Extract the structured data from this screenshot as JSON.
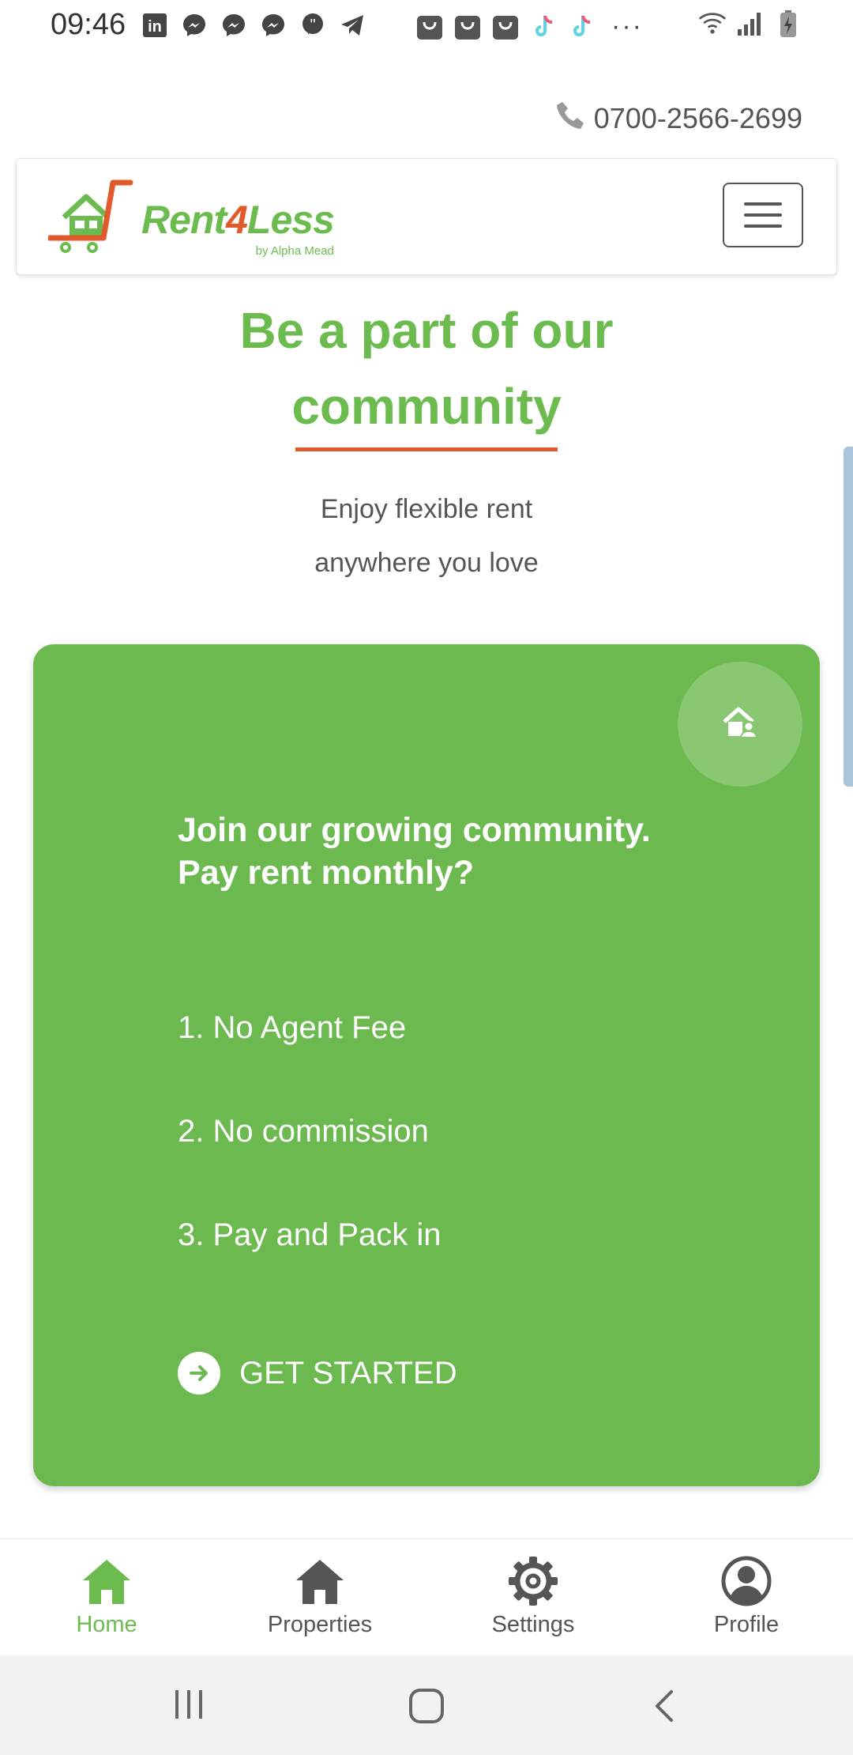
{
  "status_bar": {
    "time": "09:46",
    "notification_icons": [
      "linkedin-icon",
      "messenger-icon",
      "messenger-icon",
      "messenger-icon",
      "quote-icon",
      "telegram-icon"
    ],
    "notification_icons_2": [
      "bag-icon",
      "bag-icon",
      "bag-icon",
      "tiktok-icon",
      "tiktok-icon"
    ],
    "more": "···",
    "system_icons": [
      "wifi-icon",
      "signal-icon",
      "battery-charging-icon"
    ]
  },
  "contact": {
    "phone": "0700-2566-2699",
    "icon": "phone-icon"
  },
  "header": {
    "logo_text_part1": "Rent",
    "logo_text_part2": "4",
    "logo_text_part3": "Less",
    "logo_subtext": "by Alpha Mead",
    "menu_icon": "hamburger-icon"
  },
  "hero": {
    "title_line1": "Be a part of our",
    "title_line2": "community",
    "subtitle_line1": "Enjoy flexible rent",
    "subtitle_line2": "anywhere you love"
  },
  "card": {
    "badge_icon": "home-user-icon",
    "heading_line1": "Join our growing community.",
    "heading_line2": "Pay rent monthly?",
    "items": [
      "1. No Agent Fee",
      "2. No commission",
      "3. Pay and Pack in"
    ],
    "cta_label": "GET STARTED",
    "cta_icon": "arrow-right-circle-icon"
  },
  "bottom_nav": {
    "items": [
      {
        "label": "Home",
        "icon": "home-icon",
        "active": true
      },
      {
        "label": "Properties",
        "icon": "home-icon",
        "active": false
      },
      {
        "label": "Settings",
        "icon": "gear-icon",
        "active": false
      },
      {
        "label": "Profile",
        "icon": "user-circle-icon",
        "active": false
      }
    ]
  },
  "colors": {
    "brand_green": "#6cbb4f",
    "card_green": "#6cb950",
    "accent_orange": "#e05a2b"
  }
}
